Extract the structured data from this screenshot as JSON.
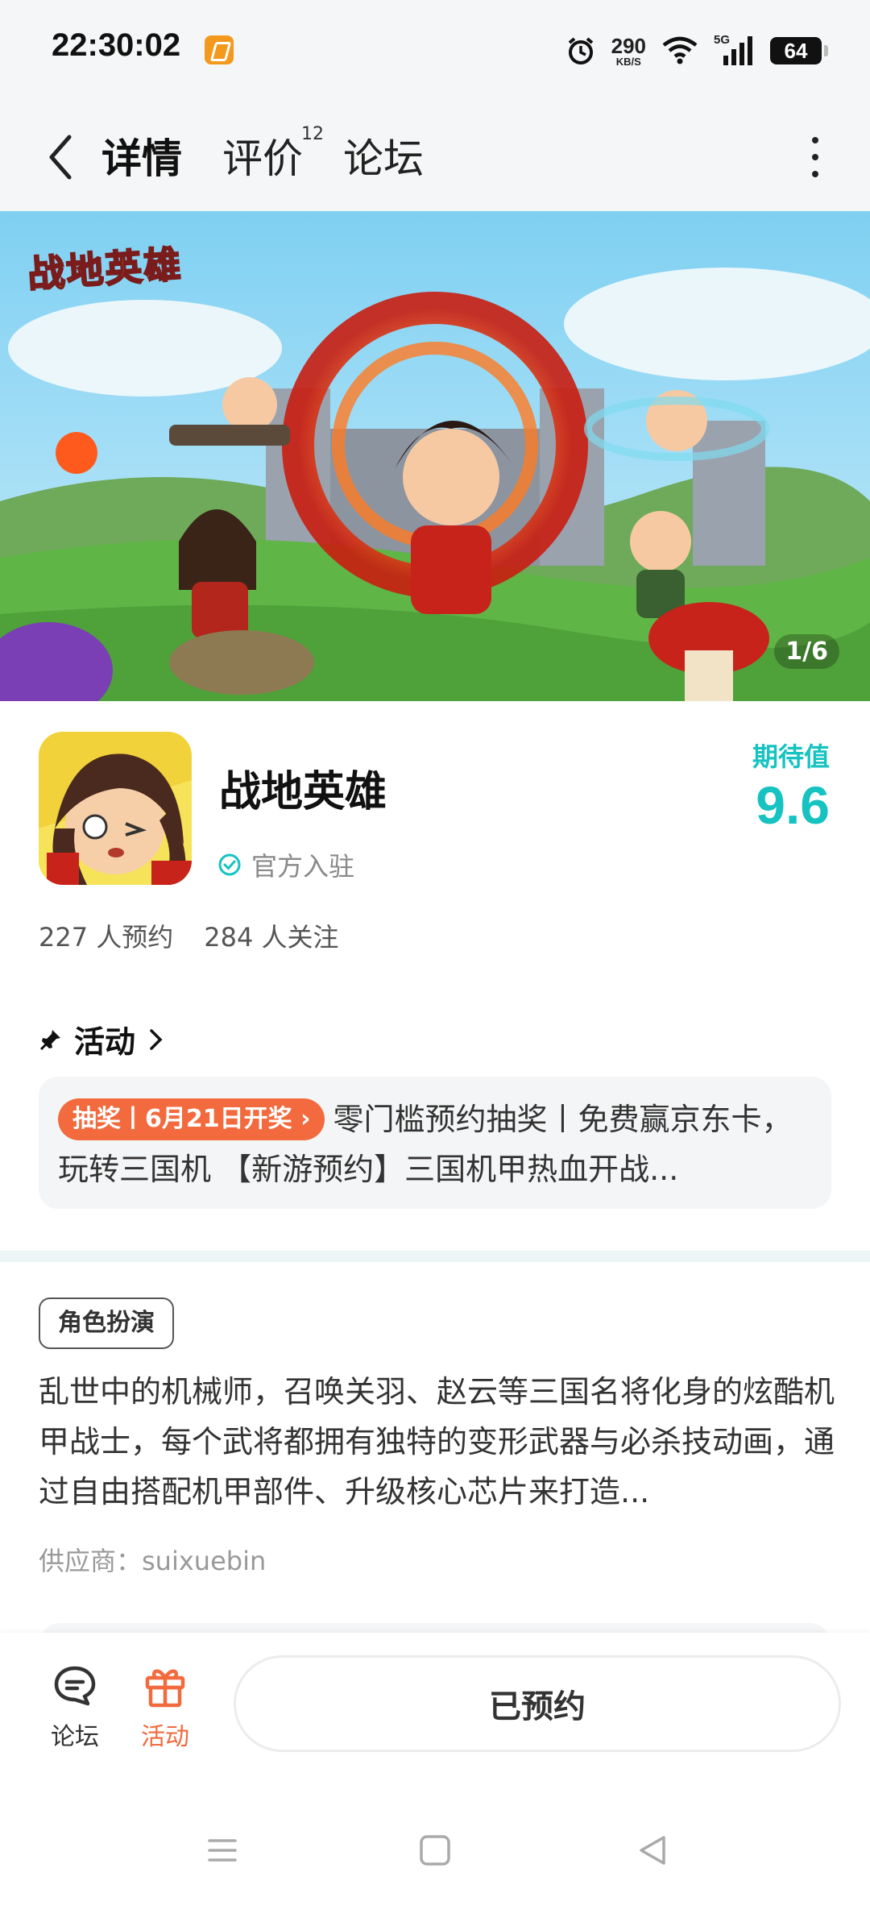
{
  "status_bar": {
    "time": "22:30:02",
    "net_speed": "290",
    "net_unit": "KB/S",
    "signal": "5G",
    "battery": "64"
  },
  "header": {
    "tabs": [
      {
        "label": "详情",
        "active": true
      },
      {
        "label": "评价",
        "badge": "12"
      },
      {
        "label": "论坛"
      }
    ]
  },
  "banner": {
    "logo_text": "战地英雄",
    "page_indicator": "1/6"
  },
  "game": {
    "title": "战地英雄",
    "official_label": "官方入驻",
    "expect_label": "期待值",
    "expect_score": "9.6",
    "reservations": "227 人预约",
    "followers": "284 人关注"
  },
  "activity": {
    "heading": "活动",
    "tag": "抽奖丨6月21日开奖",
    "text": "零门槛预约抽奖丨免费赢京东卡，玩转三国机 【新游预约】三国机甲热血开战..."
  },
  "description": {
    "genre_tag": "角色扮演",
    "text": "乱世中的机械师，召唤关羽、赵云等三国名将化身的炫酷机甲战士，每个武将都拥有独特的变形武器与必杀技动画，通过自由搭配机甲部件、升级核心芯片来打造...",
    "supplier": "供应商：suixuebin"
  },
  "bottom_bar": {
    "forum_label": "论坛",
    "activity_label": "活动",
    "reserved_label": "已预约"
  },
  "colors": {
    "accent": "#1ec8c0",
    "orange": "#f26a3d"
  }
}
